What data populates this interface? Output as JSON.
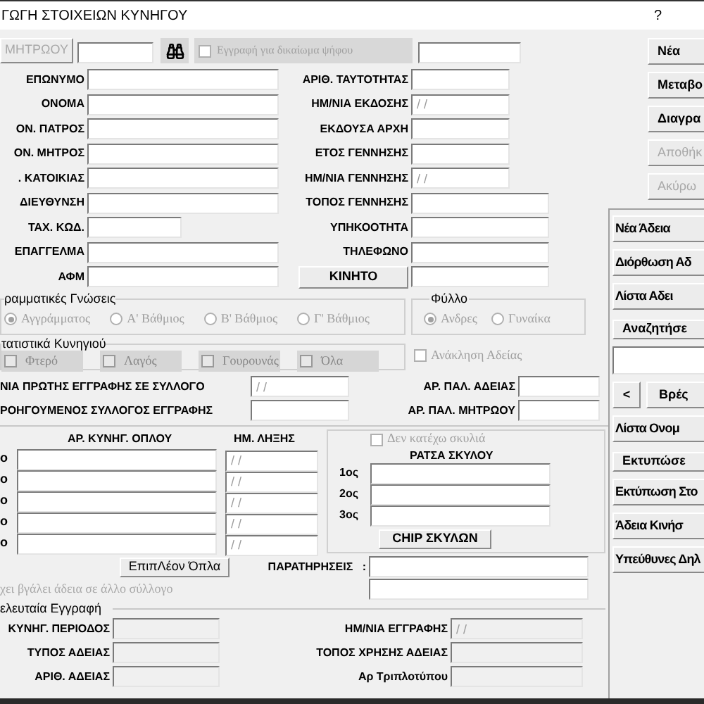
{
  "window": {
    "title": "ΓΩΓΗ ΣΤΟΙΧΕΙΩΝ ΚΥΝΗΓΟΥ",
    "help": "?"
  },
  "toolbar": {
    "registry_button": {
      "label": "ΜΗΤΡΩΟΥ",
      "disabled": true
    },
    "vote_checkbox": {
      "label": "Εγγραφή για δικαίωμα ψήφου",
      "checked": false,
      "disabled": true
    }
  },
  "person_left": [
    {
      "label": "ΕΠΩΝΥΜΟ",
      "kind": "wide"
    },
    {
      "label": "ΟΝΟΜΑ",
      "kind": "wide"
    },
    {
      "label": "ΟΝ. ΠΑΤΡΟΣ",
      "kind": "wide"
    },
    {
      "label": "ΟΝ. ΜΗΤΡΟΣ",
      "kind": "wide"
    },
    {
      "label": ". ΚΑΤΟΙΚΙΑΣ",
      "kind": "wide"
    },
    {
      "label": "ΔΙΕΥΘΥΝΣΗ",
      "kind": "wide"
    },
    {
      "label": "ΤΑΧ. ΚΩΔ.",
      "kind": "short"
    },
    {
      "label": "ΕΠΑΓΓΕΛΜΑ",
      "kind": "wide"
    },
    {
      "label": "ΑΦΜ",
      "kind": "wide"
    }
  ],
  "person_right": [
    {
      "label": "ΑΡΙΘ. ΤΑΥΤΟΤΗΤΑΣ",
      "kind": "field"
    },
    {
      "label": "ΗΜ/ΝΙΑ ΕΚΔΟΣΗΣ",
      "kind": "field",
      "value": "/ /"
    },
    {
      "label": "ΕΚΔΟΥΣΑ ΑΡΧΗ",
      "kind": "field"
    },
    {
      "label": "ΕΤΟΣ ΓΕΝΝΗΣΗΣ",
      "kind": "field"
    },
    {
      "label": "ΗΜ/ΝΙΑ ΓΕΝΝΗΣΗΣ",
      "kind": "field",
      "value": "/ /"
    },
    {
      "label": "ΤΟΠΟΣ ΓΕΝΝΗΣΗΣ",
      "kind": "wide"
    },
    {
      "label": "ΥΠΗΚΟΟΤΗΤΑ",
      "kind": "wide"
    },
    {
      "label": "ΤΗΛΕΦΩΝΟ",
      "kind": "wide"
    },
    {
      "label": "ΚΙΝΗΤΟ",
      "kind": "button"
    }
  ],
  "education": {
    "title": "ραμματικές Γνώσεις",
    "disabled": true,
    "options": [
      {
        "label": "Αγγράμματος",
        "selected": true
      },
      {
        "label": "Α' Βάθμιος",
        "selected": false
      },
      {
        "label": "Β' Βάθμιος",
        "selected": false
      },
      {
        "label": "Γ' Βάθμιος",
        "selected": false
      }
    ]
  },
  "gender": {
    "title": "Φύλλο",
    "disabled": true,
    "options": [
      {
        "label": "Ανδρες",
        "selected": true
      },
      {
        "label": "Γυναίκα",
        "selected": false
      }
    ]
  },
  "hunting_stats": {
    "title": "τατιστικά Κυνηγιού",
    "options": [
      {
        "label": "Φτερό",
        "checked": false
      },
      {
        "label": "Λαγός",
        "checked": false
      },
      {
        "label": "Γουρουνάς",
        "checked": false
      },
      {
        "label": "Όλα",
        "checked": false
      }
    ]
  },
  "revocation": {
    "label": "Ανάκληση Αδείας",
    "checked": false,
    "disabled": true
  },
  "registration": {
    "first_date": {
      "label": "ΝΙΑ ΠΡΩΤΗΣ ΕΓΓΡΑΦΗΣ ΣΕ ΣΥΛΛΟΓΟ",
      "value": "/ /"
    },
    "previous_club": {
      "label": "ΡΟΗΓΟΥΜΕΝΟΣ ΣΥΛΛΟΓΟΣ ΕΓΓΡΑΦΗΣ"
    },
    "old_license": {
      "label": "ΑΡ. ΠΑΛ. ΑΔΕΙΑΣ"
    },
    "old_registry": {
      "label": "ΑΡ. ΠΑΛ. ΜΗΤΡΩΟΥ"
    }
  },
  "weapons": {
    "headers": [
      "ΑΡ. ΚΥΝΗΓ. ΟΠΛΟΥ",
      "ΗΜ. ΛΗΞΗΣ"
    ],
    "rows": [
      {
        "label": "ο",
        "expiry": "/ /"
      },
      {
        "label": "ο",
        "expiry": "/ /"
      },
      {
        "label": "ο",
        "expiry": "/ /"
      },
      {
        "label": "ο",
        "expiry": "/ /"
      },
      {
        "label": "ο",
        "expiry": "/ /"
      }
    ]
  },
  "dogs": {
    "no_dogs": {
      "label": "Δεν κατέχω σκυλιά",
      "checked": false,
      "disabled": true
    },
    "title": "ΡΑΤΣΑ ΣΚΥΛΟΥ",
    "rows": [
      {
        "label": "1ος"
      },
      {
        "label": "2ος"
      },
      {
        "label": "3ος"
      }
    ],
    "chip_button": "CHIP ΣΚΥΛΩΝ"
  },
  "extra_weapons_button": "ΕπιπΛέον Όπλα",
  "remarks": {
    "label": "ΠΑΡΑΤΗΡΗΣΕΙΣ",
    "colon": ":"
  },
  "other_club_note": {
    "label": "χει βγάλει άδεια σε άλλο σύλλογο",
    "disabled": true
  },
  "last_record": {
    "title": "ελευταία Εγγραφή",
    "rows": [
      {
        "left": {
          "label": "ΚΥΝΗΓ. ΠΕΡΙΟΔΟΣ"
        },
        "right": {
          "label": "ΗΜ/ΝΙΑ ΕΓΓΡΑΦΗΣ",
          "value": "/ /"
        }
      },
      {
        "left": {
          "label": "ΤΥΠΟΣ ΑΔΕΙΑΣ"
        },
        "right": {
          "label": "ΤΟΠΟΣ ΧΡΗΣΗΣ ΑΔΕΙΑΣ"
        }
      },
      {
        "left": {
          "label": "ΑΡΙΘ. ΑΔΕΙΑΣ"
        },
        "right": {
          "label": "Αρ Τριπλοτύπου"
        }
      }
    ]
  },
  "actions": [
    {
      "label": "Νέα",
      "disabled": false
    },
    {
      "label": "Μεταβο",
      "disabled": false
    },
    {
      "label": "Διαγρα",
      "disabled": false
    },
    {
      "label": "Αποθήκ",
      "disabled": true
    },
    {
      "label": "Ακύρω",
      "disabled": true
    }
  ],
  "panel": [
    {
      "kind": "button",
      "label": "Νέα Άδεια"
    },
    {
      "kind": "button",
      "label": "Διόρθωση Αδ"
    },
    {
      "kind": "button",
      "label": "Λίστα Αδει"
    },
    {
      "kind": "header",
      "label": "Αναζητήσε"
    },
    {
      "kind": "field"
    },
    {
      "kind": "nav",
      "back": "<",
      "label": "Βρές"
    },
    {
      "kind": "button",
      "label": "Λίστα Ονομ"
    },
    {
      "kind": "header",
      "label": "Εκτυπώσε"
    },
    {
      "kind": "button",
      "label": "Εκτύπωση Στο"
    },
    {
      "kind": "button",
      "label": "Άδεια Κινήσ"
    },
    {
      "kind": "button",
      "label": "Υπεύθυνες Δηλ"
    }
  ]
}
